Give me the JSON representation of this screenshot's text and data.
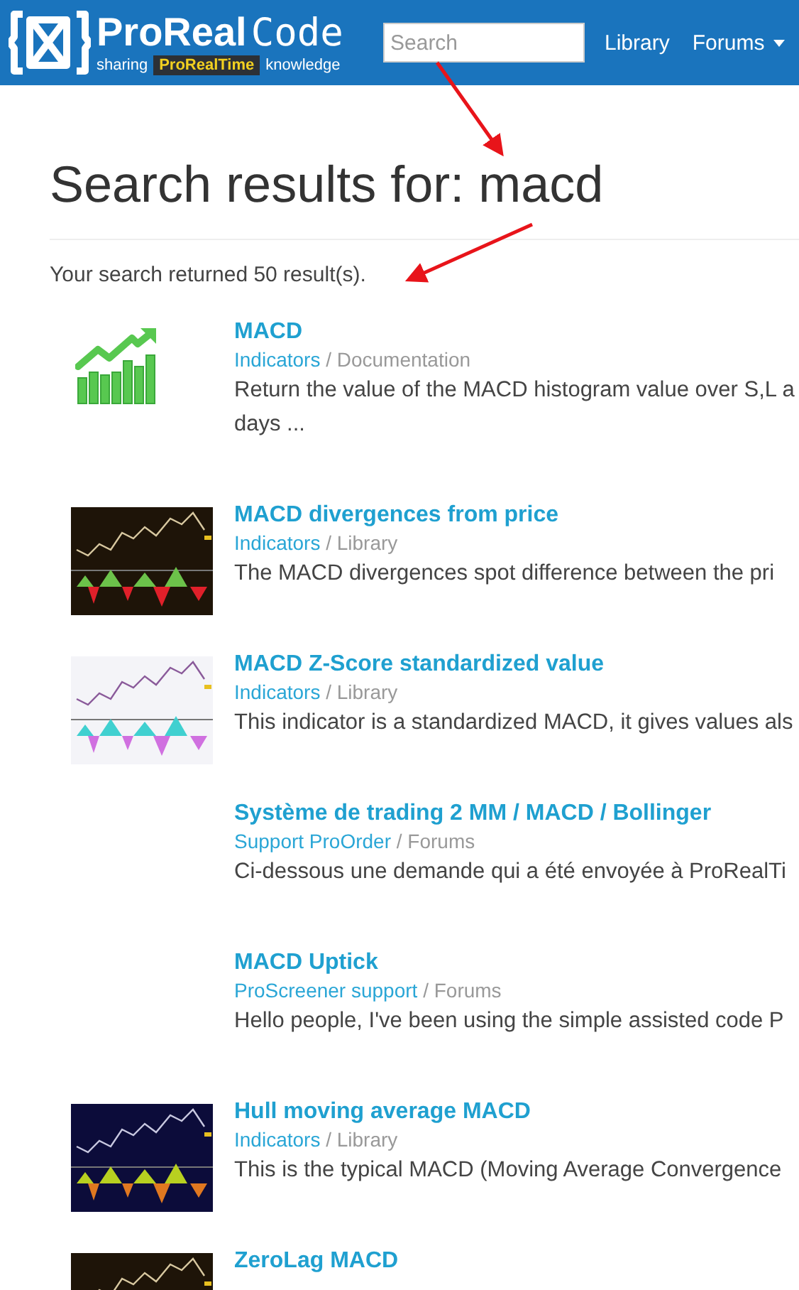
{
  "header": {
    "logo_bold": "ProReal",
    "logo_light": "Code",
    "tagline_before": "sharing",
    "tagline_badge": "ProRealTime",
    "tagline_after": "knowledge",
    "search": {
      "placeholder": "Search"
    },
    "nav": [
      {
        "label": "Library",
        "dropdown": false
      },
      {
        "label": "Forums",
        "dropdown": true
      }
    ]
  },
  "title": "Search results for: macd",
  "summary": "Your search returned 50 result(s).",
  "results": [
    {
      "kind": "icon",
      "title": "MACD",
      "category": "Indicators",
      "section": "/ Documentation",
      "lines": [
        "Return the value of the MACD histogram value over S,L a",
        "days ..."
      ]
    },
    {
      "kind": "picture",
      "title": "MACD divergences from price",
      "category": "Indicators",
      "section": "/ Library",
      "lines": [
        "The MACD divergences spot difference between the pri"
      ]
    },
    {
      "kind": "picture",
      "title": "MACD Z-Score standardized value",
      "category": "Indicators",
      "section": "/ Library",
      "lines": [
        "This indicator is a standardized MACD, it gives values als"
      ]
    },
    {
      "kind": "none",
      "title": "Système de trading 2 MM / MACD / Bollinger",
      "category": "Support ProOrder",
      "section": "/ Forums",
      "lines": [
        "Ci-dessous une demande qui a été envoyée à ProRealTi"
      ]
    },
    {
      "kind": "none",
      "title": "MACD Uptick",
      "category": "ProScreener support",
      "section": "/ Forums",
      "lines": [
        "Hello people, I've been using the simple assisted code P"
      ]
    },
    {
      "kind": "picture",
      "title": "Hull moving average MACD",
      "category": "Indicators",
      "section": "/ Library",
      "lines": [
        "This is the typical MACD (Moving Average Convergence "
      ]
    },
    {
      "kind": "picture",
      "title": "ZeroLag MACD"
    }
  ]
}
